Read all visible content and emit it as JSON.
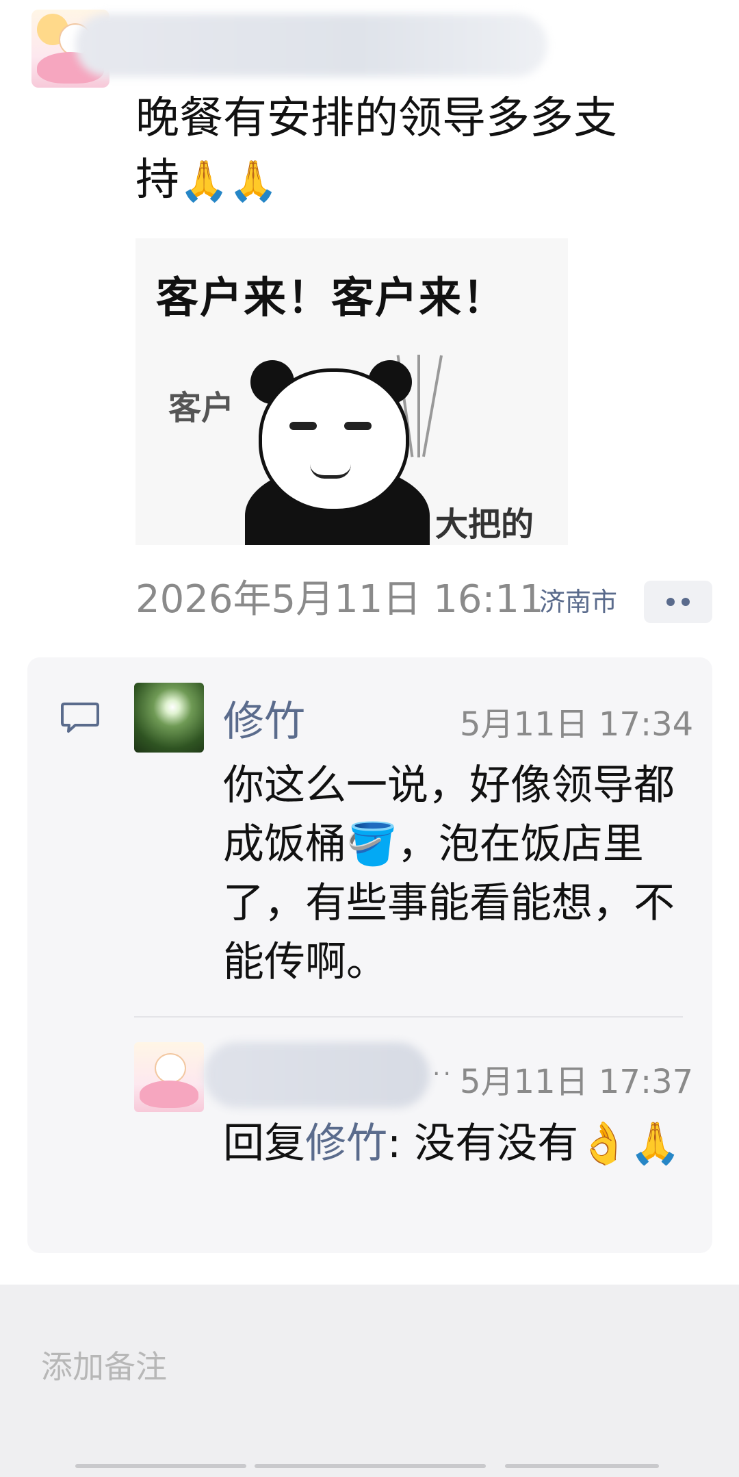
{
  "post": {
    "text_line1": "晚餐有安排的领导多多支",
    "text_line2": "持",
    "emojis": "🙏🙏",
    "image": {
      "caption": "客户来！客户来！",
      "label_left": "客户",
      "label_right": "大把的"
    },
    "time": "2026年5月11日 16:11",
    "location": "济南市"
  },
  "comments": [
    {
      "author": "修竹",
      "time": "5月11日 17:34",
      "text": "你这么一说，好像领导都成饭桶🪣，泡在饭店里了，有些事能看能想，不能传啊。"
    }
  ],
  "reply": {
    "time": "5月11日 17:37",
    "prefix": "回复",
    "mention": "修竹",
    "colon": ":",
    "text": " 没有没有👌🙏"
  },
  "note_input": {
    "placeholder": "添加备注"
  },
  "icons": {
    "comment": "comment-bubble-icon",
    "more": "more-icon"
  },
  "colors": {
    "name_blue": "#5a6b8c",
    "meta_gray": "#8a8a8a",
    "panel_bg": "#f6f6f8"
  }
}
